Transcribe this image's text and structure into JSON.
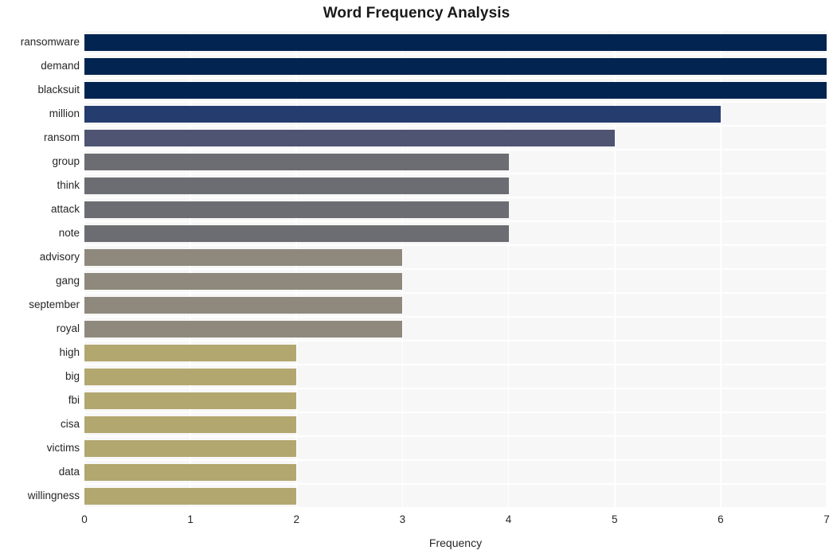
{
  "chart_data": {
    "type": "bar",
    "orientation": "horizontal",
    "title": "Word Frequency Analysis",
    "xlabel": "Frequency",
    "ylabel": "",
    "xlim": [
      0,
      7
    ],
    "xticks": [
      0,
      1,
      2,
      3,
      4,
      5,
      6,
      7
    ],
    "xtick_labels": [
      "0",
      "1",
      "2",
      "3",
      "4",
      "5",
      "6",
      "7"
    ],
    "grid": true,
    "legend": null,
    "categories": [
      "ransomware",
      "demand",
      "blacksuit",
      "million",
      "ransom",
      "group",
      "think",
      "attack",
      "note",
      "advisory",
      "gang",
      "september",
      "royal",
      "high",
      "big",
      "fbi",
      "cisa",
      "victims",
      "data",
      "willingness"
    ],
    "values": [
      7,
      7,
      7,
      6,
      5,
      4,
      4,
      4,
      4,
      3,
      3,
      3,
      3,
      2,
      2,
      2,
      2,
      2,
      2,
      2
    ],
    "bar_colors": [
      "#022450",
      "#022450",
      "#022450",
      "#253c6e",
      "#4e5471",
      "#6b6d72",
      "#6b6d72",
      "#6b6d72",
      "#6b6d72",
      "#8e897c",
      "#8e897c",
      "#8e897c",
      "#8e897c",
      "#b2a76f",
      "#b2a76f",
      "#b2a76f",
      "#b2a76f",
      "#b2a76f",
      "#b2a76f",
      "#b2a76f"
    ],
    "plot_background": "#f7f7f7",
    "gridline_color": "#ffffff",
    "figure_background": "#ffffff"
  }
}
